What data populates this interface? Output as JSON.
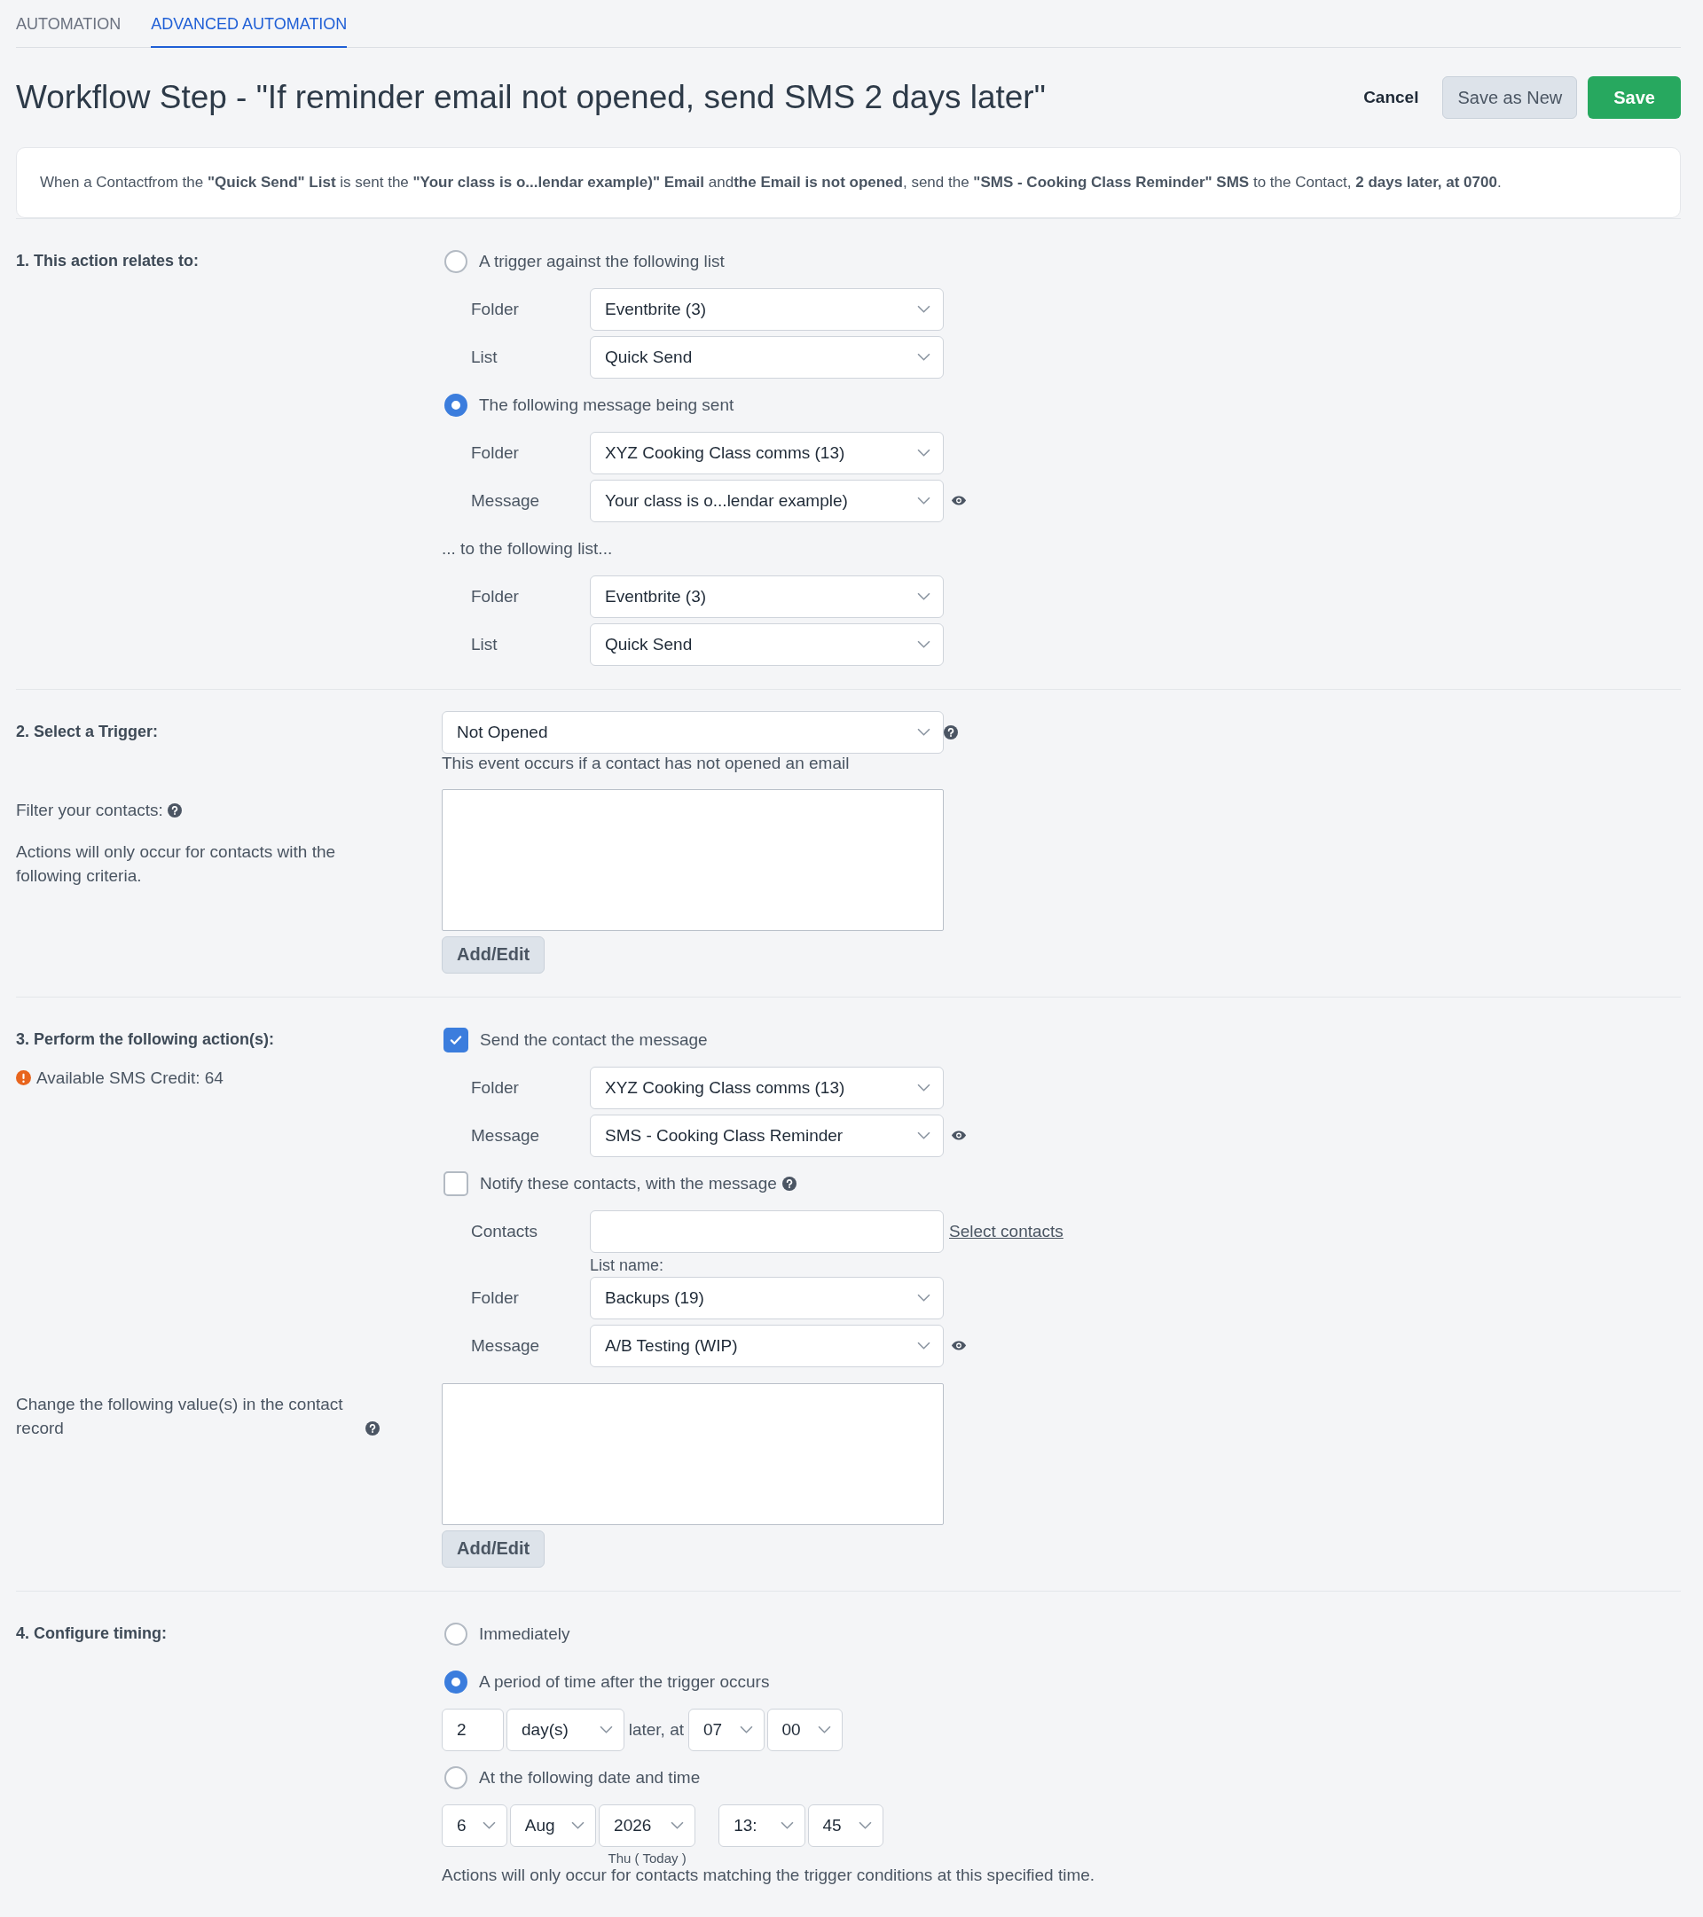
{
  "tabs": [
    {
      "label": "AUTOMATION",
      "selected": false
    },
    {
      "label": "ADVANCED AUTOMATION",
      "selected": true
    }
  ],
  "title": "Workflow Step - \"If reminder email not opened, send SMS 2 days later\"",
  "buttons": [
    {
      "label": "Cancel",
      "kind": "link"
    },
    {
      "label": "Save as New",
      "kind": "secondary"
    },
    {
      "label": "Save",
      "kind": "primary"
    }
  ],
  "summary": "When a Contactfrom the **\"Quick Send\" List** is sent the **\"Your class is o...lendar example)\" Email** and**the Email is not opened**, send the **\"SMS - Cooking Class Reminder\" SMS** to the Contact, **2 days later, at 0700**.",
  "sections": [
    {
      "blocks": [
        {
          "left": [
            {
              "kind": "heading",
              "text": "1. This action relates to:"
            }
          ],
          "right": [
            {
              "kind": "radio",
              "label": "A trigger against the following list",
              "selected": false
            },
            {
              "kind": "select",
              "label": "Folder",
              "value": "Eventbrite (3)"
            },
            {
              "kind": "select",
              "label": "List",
              "value": "Quick Send"
            },
            {
              "kind": "radio",
              "label": "The following message being sent",
              "selected": true
            },
            {
              "kind": "select",
              "label": "Folder",
              "value": "XYZ Cooking Class comms (13)"
            },
            {
              "kind": "select",
              "label": "Message",
              "value": "Your class is o...lendar example)",
              "preview": true
            },
            {
              "kind": "note",
              "text": "... to the following list..."
            },
            {
              "kind": "select",
              "label": "Folder",
              "value": "Eventbrite (3)"
            },
            {
              "kind": "select",
              "label": "List",
              "value": "Quick Send"
            }
          ]
        }
      ]
    },
    {
      "blocks": [
        {
          "left": [
            {
              "kind": "heading",
              "text": "2. Select a Trigger:"
            }
          ],
          "right": [
            {
              "kind": "dropdown",
              "value": "Not Opened",
              "help": true
            },
            {
              "kind": "helper",
              "text": "This event occurs if a contact has not opened an email"
            }
          ]
        },
        {
          "left": [
            {
              "kind": "text",
              "text": "Filter your contacts:",
              "help": true
            },
            {
              "kind": "text",
              "text": "Actions will only occur for contacts with the following criteria."
            }
          ],
          "right": [
            {
              "kind": "textarea"
            },
            {
              "kind": "button",
              "label": "Add/Edit"
            }
          ]
        }
      ]
    },
    {
      "blocks": [
        {
          "left": [
            {
              "kind": "heading",
              "text": "3. Perform the following action(s):"
            },
            {
              "kind": "alert",
              "text": "Available SMS Credit: 64"
            }
          ],
          "right": [
            {
              "kind": "checkbox",
              "label": "Send the contact the message",
              "checked": true
            },
            {
              "kind": "select",
              "label": "Folder",
              "value": "XYZ Cooking Class comms (13)"
            },
            {
              "kind": "select",
              "label": "Message",
              "value": "SMS - Cooking Class Reminder",
              "preview": true
            },
            {
              "kind": "checkbox",
              "label": "Notify these contacts, with the message",
              "checked": false,
              "help": true
            },
            {
              "kind": "input",
              "label": "Contacts",
              "link": "Select contacts"
            },
            {
              "kind": "caption",
              "text": "List name:"
            },
            {
              "kind": "select",
              "label": "Folder",
              "value": "Backups (19)"
            },
            {
              "kind": "select",
              "label": "Message",
              "value": "A/B Testing (WIP)",
              "preview": true
            }
          ]
        },
        {
          "left": [
            {
              "kind": "text",
              "text": "Change the following value(s) in the contact record",
              "help": true
            }
          ],
          "right": [
            {
              "kind": "textarea"
            },
            {
              "kind": "button",
              "label": "Add/Edit"
            }
          ]
        }
      ]
    },
    {
      "blocks": [
        {
          "left": [
            {
              "kind": "heading",
              "text": "4. Configure timing:"
            }
          ],
          "right": [
            {
              "kind": "radio",
              "label": "Immediately",
              "selected": false
            },
            {
              "kind": "radio",
              "label": "A period of time after the trigger occurs",
              "selected": true
            },
            {
              "kind": "inline",
              "items": [
                {
                  "kind": "input",
                  "value": "2"
                },
                {
                  "kind": "select",
                  "value": "day(s)"
                },
                {
                  "kind": "text",
                  "text": "later, at"
                },
                {
                  "kind": "select",
                  "value": "07"
                },
                {
                  "kind": "select",
                  "value": "00"
                }
              ]
            },
            {
              "kind": "radio",
              "label": "At the following date and time",
              "selected": false
            },
            {
              "kind": "inline",
              "items": [
                {
                  "kind": "select",
                  "value": "6"
                },
                {
                  "kind": "select",
                  "value": "Aug"
                },
                {
                  "kind": "select",
                  "value": "2026",
                  "caption": "Thu ( Today )"
                },
                {
                  "kind": "gap"
                },
                {
                  "kind": "select",
                  "value": "13:"
                },
                {
                  "kind": "select",
                  "value": "45"
                }
              ]
            },
            {
              "kind": "helper",
              "text": "Actions will only occur for contacts matching the trigger conditions at this specified time."
            }
          ]
        }
      ]
    }
  ]
}
